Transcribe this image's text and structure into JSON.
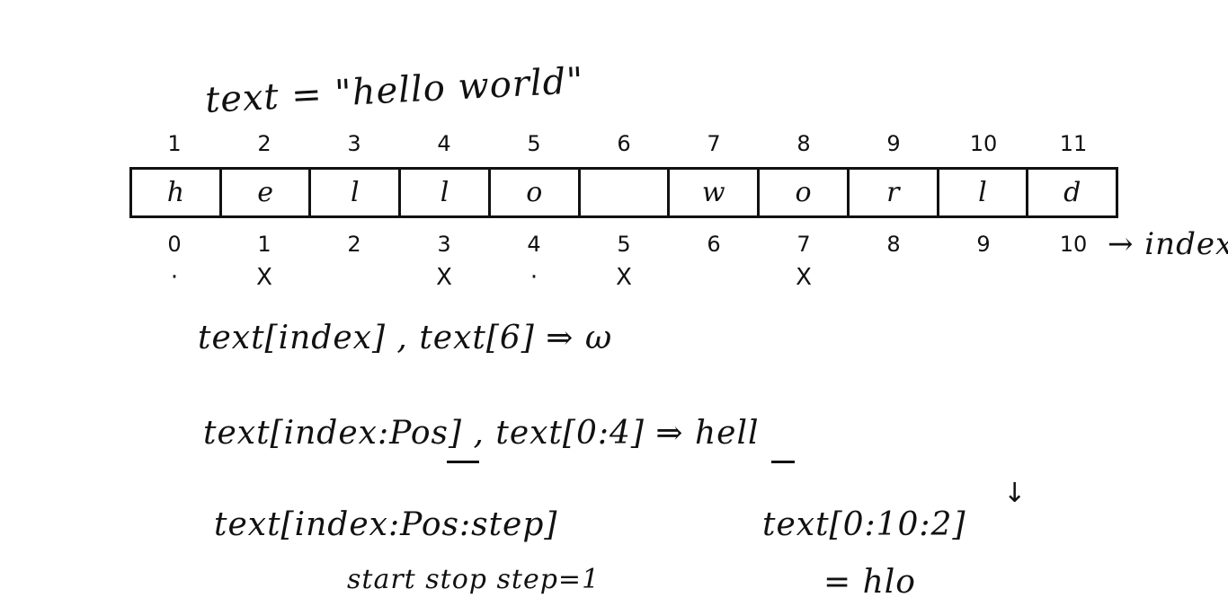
{
  "title": "text = \"hello world\"",
  "array": {
    "chars": [
      "h",
      "e",
      "l",
      "l",
      "o",
      "",
      "w",
      "o",
      "r",
      "l",
      "d"
    ],
    "positions": [
      "1",
      "2",
      "3",
      "4",
      "5",
      "6",
      "7",
      "8",
      "9",
      "10",
      "11"
    ],
    "indices": [
      "0",
      "1",
      "2",
      "3",
      "4",
      "5",
      "6",
      "7",
      "8",
      "9",
      "10"
    ],
    "marks": [
      "·",
      "X",
      "",
      "X",
      "·",
      "X",
      "",
      "X",
      "",
      "",
      ""
    ],
    "index_label": "→ index"
  },
  "expressions": {
    "e1": "text[index] , text[6] ⇒ ω",
    "e2": "text[index:Pos] , text[0:4] ⇒ hell",
    "e3": "text[index:Pos:step]",
    "e3_note": "start stop step=1",
    "e4": "text[0:10:2]",
    "e4_result": "= hlo",
    "down_arrow": "↓"
  }
}
